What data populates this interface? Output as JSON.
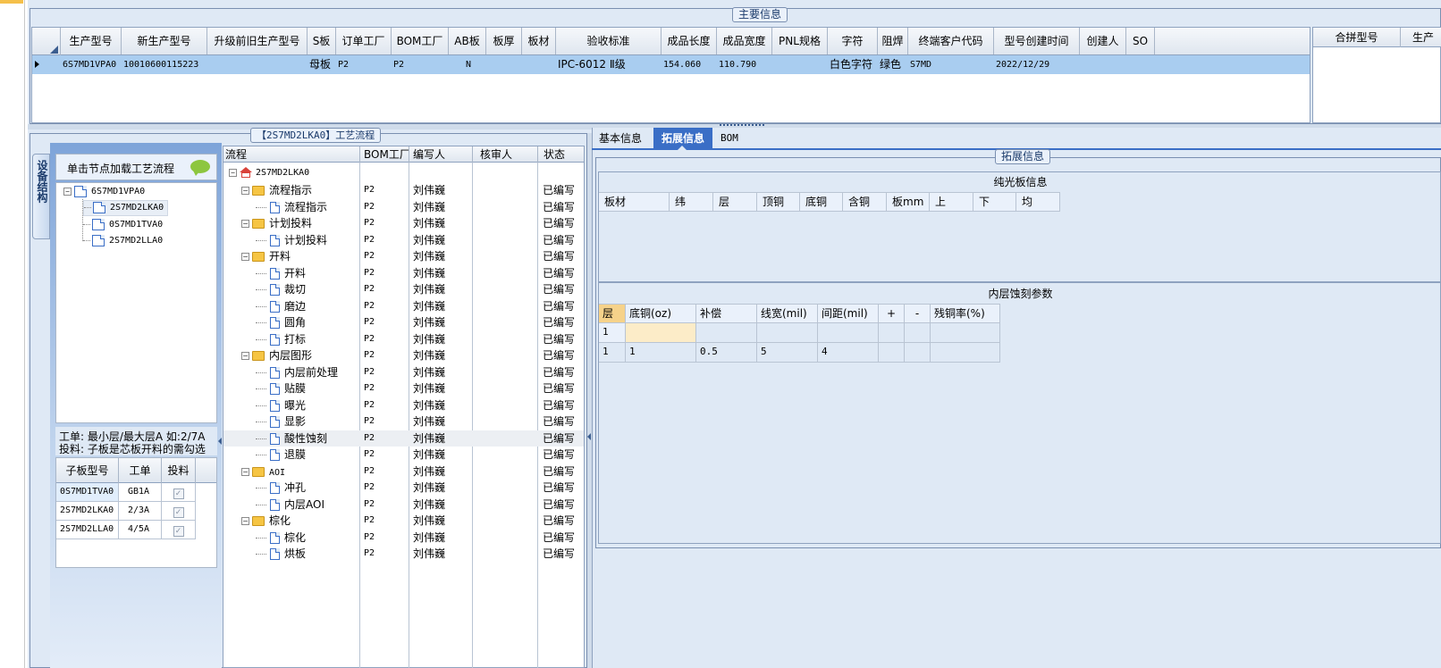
{
  "main_info": {
    "title": "主要信息",
    "columns": [
      "生产型号",
      "新生产型号",
      "升级前旧生产型号",
      "S板",
      "订单工厂",
      "BOM工厂",
      "AB板",
      "板厚",
      "板材",
      "验收标准",
      "成品长度",
      "成品宽度",
      "PNL规格",
      "字符",
      "阻焊",
      "终端客户代码",
      "型号创建时间",
      "创建人",
      "SO"
    ],
    "row": [
      "6S7MD1VPA0",
      "10010600115223",
      "",
      "母板",
      "P2",
      "P2",
      "N",
      "",
      "",
      "IPC-6012 Ⅱ级",
      "154.060",
      "110.790",
      "",
      "白色字符",
      "绿色",
      "S7MD",
      "2022/12/29",
      "",
      ""
    ],
    "right_columns": [
      "合拼型号",
      "生产"
    ]
  },
  "process_panel": {
    "title": "【2S7MD2LKA0】工艺流程",
    "side_tab": "设备结构",
    "hint": "单击节点加载工艺流程",
    "tree": [
      {
        "label": "6S7MD1VPA0",
        "depth": 0
      },
      {
        "label": "2S7MD2LKA0",
        "depth": 1
      },
      {
        "label": "0S7MD1TVA0",
        "depth": 1
      },
      {
        "label": "2S7MD2LLA0",
        "depth": 1
      }
    ],
    "note_line1": "工单: 最小层/最大层A 如:2/7A",
    "note_line2": "投料: 子板是芯板开料的需勾选",
    "sub_columns": [
      "子板型号",
      "工单",
      "投料"
    ],
    "sub_rows": [
      [
        "0S7MD1TVA0",
        "GB1A"
      ],
      [
        "2S7MD2LKA0",
        "2/3A"
      ],
      [
        "2S7MD2LLA0",
        "4/5A"
      ]
    ]
  },
  "flow": {
    "columns": [
      "流程",
      "BOM工厂",
      "编写人",
      "核审人",
      "状态"
    ],
    "root": "2S7MD2LKA0",
    "rows": [
      {
        "label": "流程指示",
        "type": "folder",
        "depth": 1,
        "factory": "P2",
        "writer": "刘伟巍",
        "status": "已编写"
      },
      {
        "label": "流程指示",
        "type": "doc",
        "depth": 2,
        "factory": "P2",
        "writer": "刘伟巍",
        "status": "已编写"
      },
      {
        "label": "计划投料",
        "type": "folder",
        "depth": 1,
        "factory": "P2",
        "writer": "刘伟巍",
        "status": "已编写"
      },
      {
        "label": "计划投料",
        "type": "doc",
        "depth": 2,
        "factory": "P2",
        "writer": "刘伟巍",
        "status": "已编写"
      },
      {
        "label": "开料",
        "type": "folder",
        "depth": 1,
        "factory": "P2",
        "writer": "刘伟巍",
        "status": "已编写"
      },
      {
        "label": "开料",
        "type": "doc",
        "depth": 2,
        "factory": "P2",
        "writer": "刘伟巍",
        "status": "已编写"
      },
      {
        "label": "裁切",
        "type": "doc",
        "depth": 2,
        "factory": "P2",
        "writer": "刘伟巍",
        "status": "已编写"
      },
      {
        "label": "磨边",
        "type": "doc",
        "depth": 2,
        "factory": "P2",
        "writer": "刘伟巍",
        "status": "已编写"
      },
      {
        "label": "圆角",
        "type": "doc",
        "depth": 2,
        "factory": "P2",
        "writer": "刘伟巍",
        "status": "已编写"
      },
      {
        "label": "打标",
        "type": "doc",
        "depth": 2,
        "factory": "P2",
        "writer": "刘伟巍",
        "status": "已编写"
      },
      {
        "label": "内层图形",
        "type": "folder",
        "depth": 1,
        "factory": "P2",
        "writer": "刘伟巍",
        "status": "已编写"
      },
      {
        "label": "内层前处理",
        "type": "doc",
        "depth": 2,
        "factory": "P2",
        "writer": "刘伟巍",
        "status": "已编写"
      },
      {
        "label": "贴膜",
        "type": "doc",
        "depth": 2,
        "factory": "P2",
        "writer": "刘伟巍",
        "status": "已编写"
      },
      {
        "label": "曝光",
        "type": "doc",
        "depth": 2,
        "factory": "P2",
        "writer": "刘伟巍",
        "status": "已编写"
      },
      {
        "label": "显影",
        "type": "doc",
        "depth": 2,
        "factory": "P2",
        "writer": "刘伟巍",
        "status": "已编写"
      },
      {
        "label": "酸性蚀刻",
        "type": "doc",
        "depth": 2,
        "factory": "P2",
        "writer": "刘伟巍",
        "status": "已编写"
      },
      {
        "label": "退膜",
        "type": "doc",
        "depth": 2,
        "factory": "P2",
        "writer": "刘伟巍",
        "status": "已编写"
      },
      {
        "label": "AOI",
        "type": "folder",
        "depth": 1,
        "factory": "P2",
        "writer": "刘伟巍",
        "status": "已编写"
      },
      {
        "label": "冲孔",
        "type": "doc",
        "depth": 2,
        "factory": "P2",
        "writer": "刘伟巍",
        "status": "已编写"
      },
      {
        "label": "内层AOI",
        "type": "doc",
        "depth": 2,
        "factory": "P2",
        "writer": "刘伟巍",
        "status": "已编写"
      },
      {
        "label": "棕化",
        "type": "folder",
        "depth": 1,
        "factory": "P2",
        "writer": "刘伟巍",
        "status": "已编写"
      },
      {
        "label": "棕化",
        "type": "doc",
        "depth": 2,
        "factory": "P2",
        "writer": "刘伟巍",
        "status": "已编写"
      },
      {
        "label": "烘板",
        "type": "doc",
        "depth": 2,
        "factory": "P2",
        "writer": "刘伟巍",
        "status": "已编写"
      }
    ]
  },
  "right_panel": {
    "tabs": [
      "基本信息",
      "拓展信息",
      "BOM"
    ],
    "group_title": "拓展信息",
    "bare_board_title": "纯光板信息",
    "bare_board_columns": [
      "板材",
      "纬",
      "层",
      "顶铜",
      "底铜",
      "含铜",
      "板mm",
      "上",
      "下",
      "均"
    ],
    "etch_title": "内层蚀刻参数",
    "etch_columns": [
      "层",
      "底铜(oz)",
      "补偿",
      "线宽(mil)",
      "间距(mil)",
      "+",
      "-",
      "残铜率(%)"
    ],
    "etch_rows": [
      [
        "1",
        "",
        "",
        "",
        "",
        "",
        "",
        ""
      ],
      [
        "1",
        "1",
        "0.5",
        "5",
        "4",
        "",
        "",
        ""
      ]
    ]
  }
}
